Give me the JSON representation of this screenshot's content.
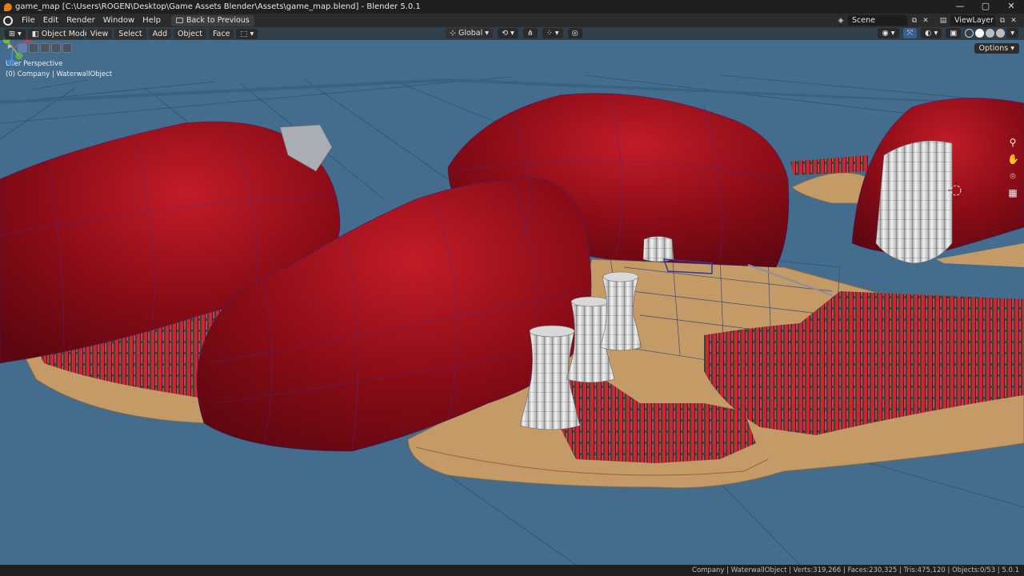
{
  "window": {
    "title": "game_map [C:\\Users\\ROGEN\\Desktop\\Game Assets Blender\\Assets\\game_map.blend] - Blender 5.0.1",
    "controls": [
      "—",
      "▢",
      "✕"
    ]
  },
  "topbar": {
    "menus": [
      "File",
      "Edit",
      "Render",
      "Window",
      "Help"
    ],
    "back_label": "Back to Previous",
    "scene_label": "Scene",
    "view_layer_label": "ViewLayer"
  },
  "viewport_header": {
    "mode_label": "Object Mode",
    "menus": [
      "View",
      "Select",
      "Add",
      "Object",
      "Face"
    ],
    "orientation_label": "Global",
    "options_label": "Options"
  },
  "viewport": {
    "perspective_label": "User Perspective",
    "object_info": "(0) Company | WaterwallObject"
  },
  "statusbar": {
    "stats": "Company | WaterwallObject | Verts:319,266 | Faces:230,325 | Tris:475,120 | Objects:0/53 | 5.0.1"
  },
  "colors": {
    "water": "#446c8c",
    "dome": "#8c0c18",
    "island": "#c49a66",
    "building_red": "#c8232e",
    "building_green": "#2a5a3a",
    "tower": "#e6e6e6"
  }
}
